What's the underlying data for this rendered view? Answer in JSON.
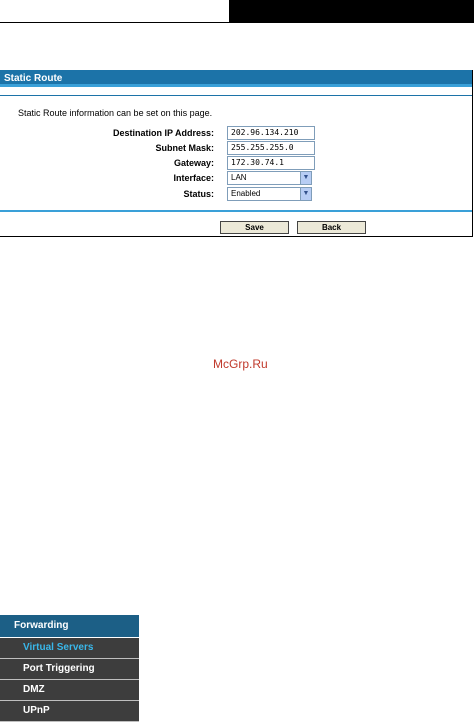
{
  "panel": {
    "title": "Static Route",
    "info": "Static Route information can be set on this page."
  },
  "form": {
    "destination_label": "Destination IP Address:",
    "destination_value": "202.96.134.210",
    "subnet_label": "Subnet Mask:",
    "subnet_value": "255.255.255.0",
    "gateway_label": "Gateway:",
    "gateway_value": "172.30.74.1",
    "interface_label": "Interface:",
    "interface_value": "LAN",
    "status_label": "Status:",
    "status_value": "Enabled"
  },
  "buttons": {
    "save": "Save",
    "back": "Back"
  },
  "watermark": "McGrp.Ru",
  "nav": {
    "header": "Forwarding",
    "items": [
      {
        "label": "Virtual Servers",
        "active": true
      },
      {
        "label": "Port Triggering",
        "active": false
      },
      {
        "label": "DMZ",
        "active": false
      },
      {
        "label": "UPnP",
        "active": false
      }
    ]
  },
  "colors": {
    "header_blue": "#1c73a8",
    "accent_blue": "#3aa0d8",
    "nav_active": "#39b7ea",
    "nav_bg": "#3d3d3d"
  },
  "icons": {
    "select_arrow": "chevron-down-icon"
  }
}
